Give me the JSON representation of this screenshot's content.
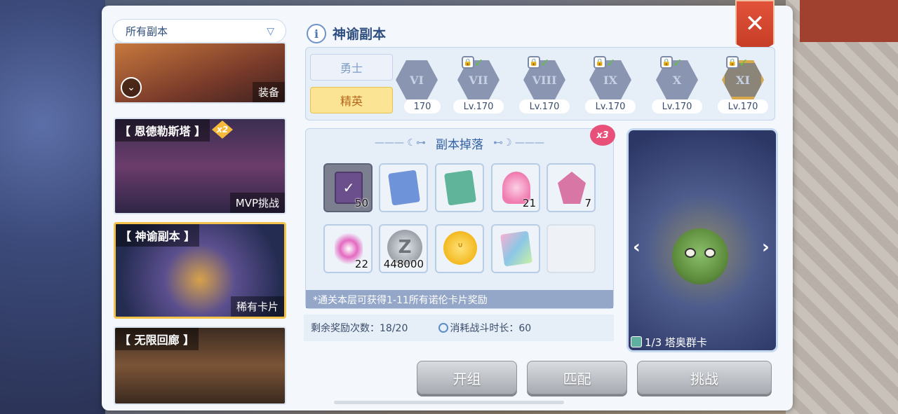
{
  "filter": {
    "selected": "所有副本"
  },
  "dungeon_list": [
    {
      "title": "",
      "tag": "装备"
    },
    {
      "title": "【 恩德勒斯塔 】",
      "tag": "MVP挑战",
      "badge": "x2"
    },
    {
      "title": "【 神谕副本 】",
      "tag": "稀有卡片"
    },
    {
      "title": "【 无限回廊 】",
      "tag": ""
    }
  ],
  "panel": {
    "title": "神谕副本",
    "info_icon": "i"
  },
  "difficulty": {
    "warrior": "勇士",
    "elite": "精英",
    "selected": "精英"
  },
  "levels": [
    {
      "numeral": "VI",
      "level": "170"
    },
    {
      "numeral": "VII",
      "level": "Lv.170"
    },
    {
      "numeral": "VIII",
      "level": "Lv.170"
    },
    {
      "numeral": "IX",
      "level": "Lv.170"
    },
    {
      "numeral": "X",
      "level": "Lv.170"
    },
    {
      "numeral": "XI",
      "level": "Lv.170"
    }
  ],
  "drops": {
    "title": "副本掉落",
    "multiplier": "x3",
    "items": [
      {
        "name": "card-pack-purple-icon",
        "qty": "50",
        "color": "#6b4f8c"
      },
      {
        "name": "card-book-blue-icon",
        "qty": "",
        "color": "#6f93d8"
      },
      {
        "name": "card-book-green-icon",
        "qty": "",
        "color": "#5fb49a"
      },
      {
        "name": "pink-powder-icon",
        "qty": "21",
        "color": "#f07bb0"
      },
      {
        "name": "pink-crystal-icon",
        "qty": "7",
        "color": "#d877a6"
      },
      {
        "name": "pink-spark-icon",
        "qty": "22",
        "color": "#e46ac2"
      },
      {
        "name": "zeny-coin-icon",
        "qty": "448000",
        "color": "#9aa0a8"
      },
      {
        "name": "gold-coin-icon",
        "qty": "",
        "color": "#f3b91f"
      },
      {
        "name": "rainbow-card-icon",
        "qty": "",
        "color": "#8bc7e6"
      },
      {
        "name": "empty-slot",
        "qty": "",
        "color": ""
      }
    ],
    "note": "*通关本层可获得1-11所有诺伦卡片奖励"
  },
  "stats": {
    "remaining_label": "剩余奖励次数：18/20",
    "cost_label": "消耗战斗时长：60"
  },
  "card_preview": {
    "label": "1/3 塔奥群卡"
  },
  "actions": {
    "team": "开组",
    "match": "匹配",
    "challenge": "挑战"
  },
  "close_label": "✕"
}
